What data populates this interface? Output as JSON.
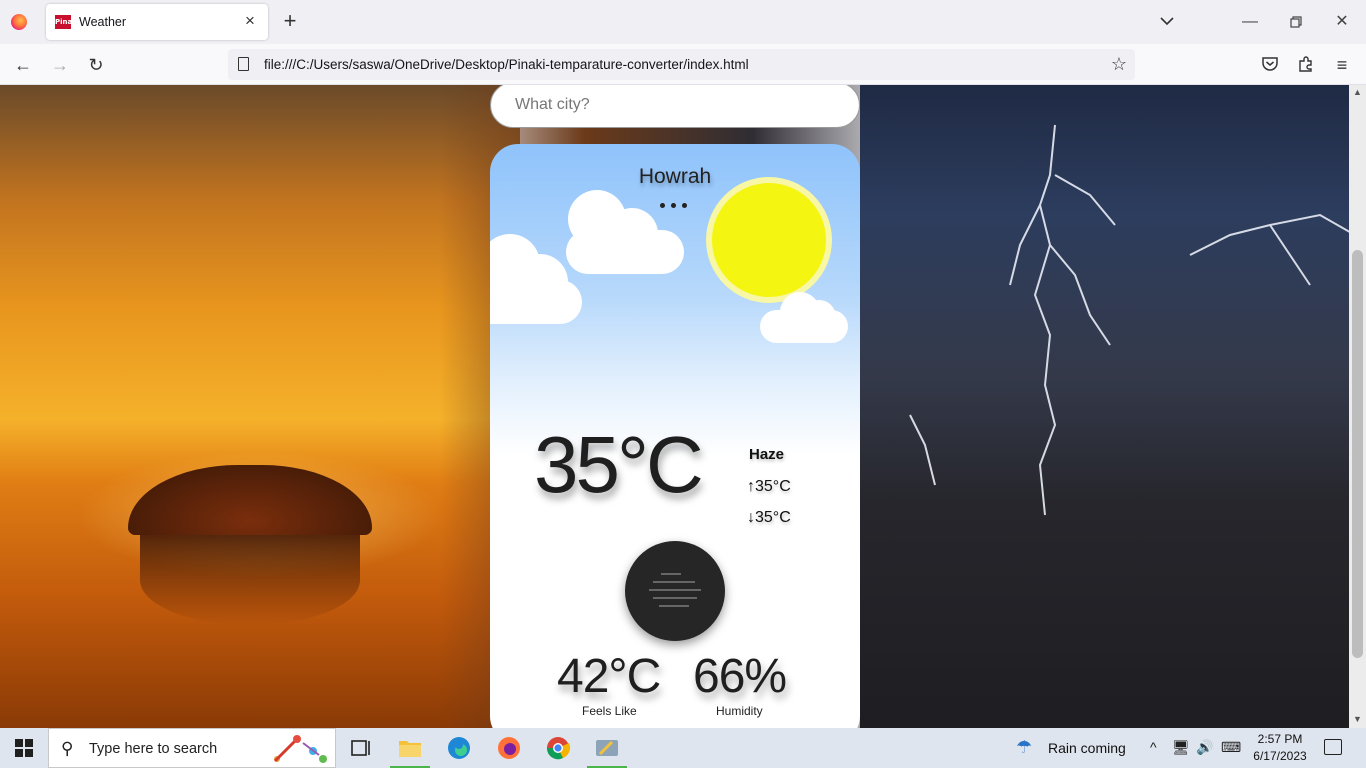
{
  "browser": {
    "tab_title": "Weather",
    "tab_favicon_text": "Pinaki",
    "url": "file:///C:/Users/saswa/OneDrive/Desktop/Pinaki-temparature-converter/index.html"
  },
  "app": {
    "search_placeholder": "What city?",
    "city": "Howrah",
    "temperature": "35°C",
    "condition": "Haze",
    "max_temp": "35°C",
    "min_temp": "35°C",
    "max_arrow": "↑",
    "min_arrow": "↓",
    "feels_like_value": "42°C",
    "feels_like_label": "Feels Like",
    "humidity_value": "66%",
    "humidity_label": "Humidity",
    "weather_icon": "haze-icon",
    "colors": {
      "sky_top": "#8fc3fb",
      "sun": "#f5f512",
      "icon_bg": "#262626"
    }
  },
  "taskbar": {
    "search_placeholder": "Type here to search",
    "weather_text": "Rain coming",
    "time": "2:57 PM",
    "date": "6/17/2023"
  }
}
